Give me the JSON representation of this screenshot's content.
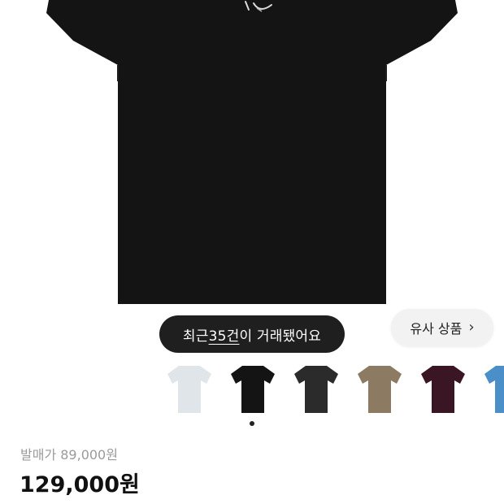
{
  "product": {
    "image_icon": "black-tshirt-icon"
  },
  "trade_banner": {
    "prefix": "최근 ",
    "count": "35건",
    "suffix": "이 거래됐어요"
  },
  "similar": {
    "label": "유사 상품",
    "icon": "chevron-right-icon",
    "chevron": "›"
  },
  "thumbnails": [
    {
      "color": "#dfe5e9",
      "name": "white"
    },
    {
      "color": "#141414",
      "name": "black"
    },
    {
      "color": "#2b2b2b",
      "name": "charcoal"
    },
    {
      "color": "#8d7a62",
      "name": "khaki"
    },
    {
      "color": "#3a1624",
      "name": "burgundy"
    },
    {
      "color": "#4a8fc7",
      "name": "blue"
    }
  ],
  "carousel": {
    "active_index": 0,
    "total": 1
  },
  "pricing": {
    "release_price": "발매가 89,000원",
    "price": "129,000원"
  }
}
